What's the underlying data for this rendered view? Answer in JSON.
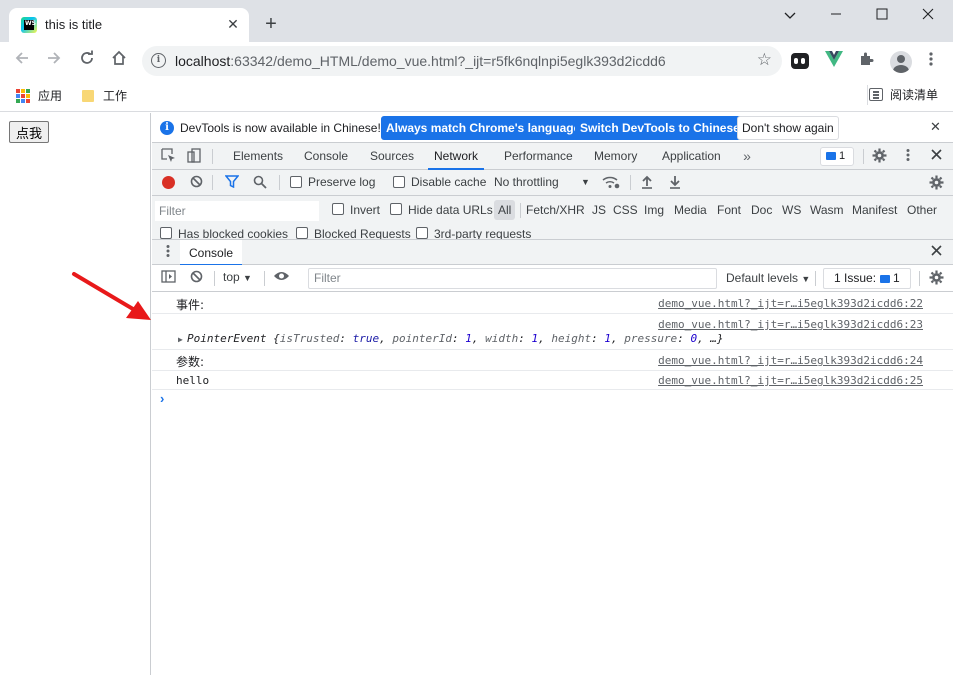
{
  "browser": {
    "tab_title": "this is title",
    "url_host": "localhost",
    "url_rest": ":63342/demo_HTML/demo_vue.html?_ijt=r5fk6nqlnpi5eglk393d2icdd6"
  },
  "bookmarks": {
    "apps": "应用",
    "work": "工作",
    "reading_list": "阅读清单"
  },
  "page": {
    "button_label": "点我"
  },
  "devtools": {
    "infobar": {
      "text": "DevTools is now available in Chinese!",
      "btn_match": "Always match Chrome's language",
      "btn_switch": "Switch DevTools to Chinese",
      "btn_dont_show": "Don't show again"
    },
    "tabs": [
      "Elements",
      "Console",
      "Sources",
      "Network",
      "Performance",
      "Memory",
      "Application"
    ],
    "active_tab": "Network",
    "issues_badge": "1",
    "network": {
      "preserve_log": "Preserve log",
      "disable_cache": "Disable cache",
      "throttling": "No throttling",
      "filter_placeholder": "Filter",
      "invert": "Invert",
      "hide_data_urls": "Hide data URLs",
      "types": [
        "All",
        "Fetch/XHR",
        "JS",
        "CSS",
        "Img",
        "Media",
        "Font",
        "Doc",
        "WS",
        "Wasm",
        "Manifest",
        "Other"
      ],
      "has_blocked_cookies": "Has blocked cookies",
      "blocked_requests": "Blocked Requests",
      "third_party": "3rd-party requests"
    },
    "drawer": {
      "tab": "Console"
    },
    "console": {
      "context": "top",
      "filter_placeholder": "Filter",
      "levels": "Default levels",
      "issues_label": "1 Issue:",
      "issues_count": "1",
      "messages": [
        {
          "text": "事件:",
          "source": "demo_vue.html?_ijt=r…i5eglk393d2icdd6:22"
        },
        {
          "text": "",
          "source": "demo_vue.html?_ijt=r…i5eglk393d2icdd6:23"
        },
        {
          "text": "参数:",
          "source": "demo_vue.html?_ijt=r…i5eglk393d2icdd6:24"
        },
        {
          "text": "hello",
          "source": "demo_vue.html?_ijt=r…i5eglk393d2icdd6:25"
        }
      ],
      "object_preview": {
        "class": "PointerEvent",
        "isTrusted": "true",
        "pointerId": "1",
        "width": "1",
        "height": "1",
        "pressure": "0"
      }
    }
  },
  "colors": {
    "accent": "#1a73e8",
    "record": "#d93025",
    "arrow": "#e8191a"
  }
}
